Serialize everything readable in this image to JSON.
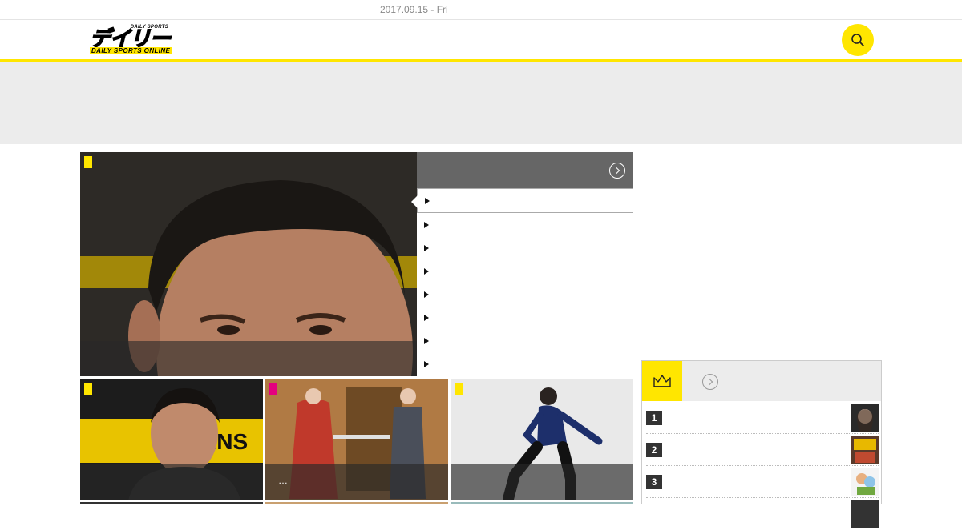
{
  "topbar": {
    "date": "2017.09.15 - Fri"
  },
  "logo": {
    "small_text": "DAILY SPORTS",
    "big_text": "デイリー",
    "sub_text": "DAILY SPORTS ONLINE"
  },
  "thumbs": [
    {
      "caption": ""
    },
    {
      "caption": "…"
    },
    {
      "caption": ""
    }
  ],
  "ranking": {
    "numbers": [
      "1",
      "2",
      "3"
    ]
  },
  "colors": {
    "accent": "#ffe600",
    "category_pink": "#e4007f",
    "panel_gray": "#666666"
  }
}
